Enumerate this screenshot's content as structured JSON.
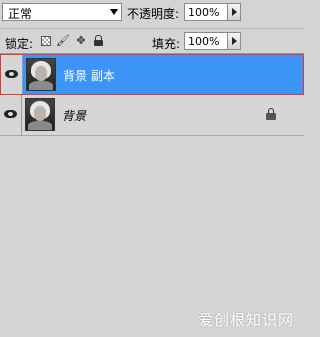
{
  "blend": {
    "mode": "正常"
  },
  "opacity": {
    "label": "不透明度:",
    "value": "100%"
  },
  "lock": {
    "label": "锁定:"
  },
  "fill": {
    "label": "填充:",
    "value": "100%"
  },
  "layers": [
    {
      "name": "背景 副本",
      "selected": true,
      "visible": true
    },
    {
      "name": "背景",
      "selected": false,
      "visible": true,
      "locked": true
    }
  ],
  "watermark": "爱创根知识网",
  "colors": {
    "selection": "#3c95f7",
    "selection_border": "#e03838",
    "panel": "#d6d6d6"
  }
}
